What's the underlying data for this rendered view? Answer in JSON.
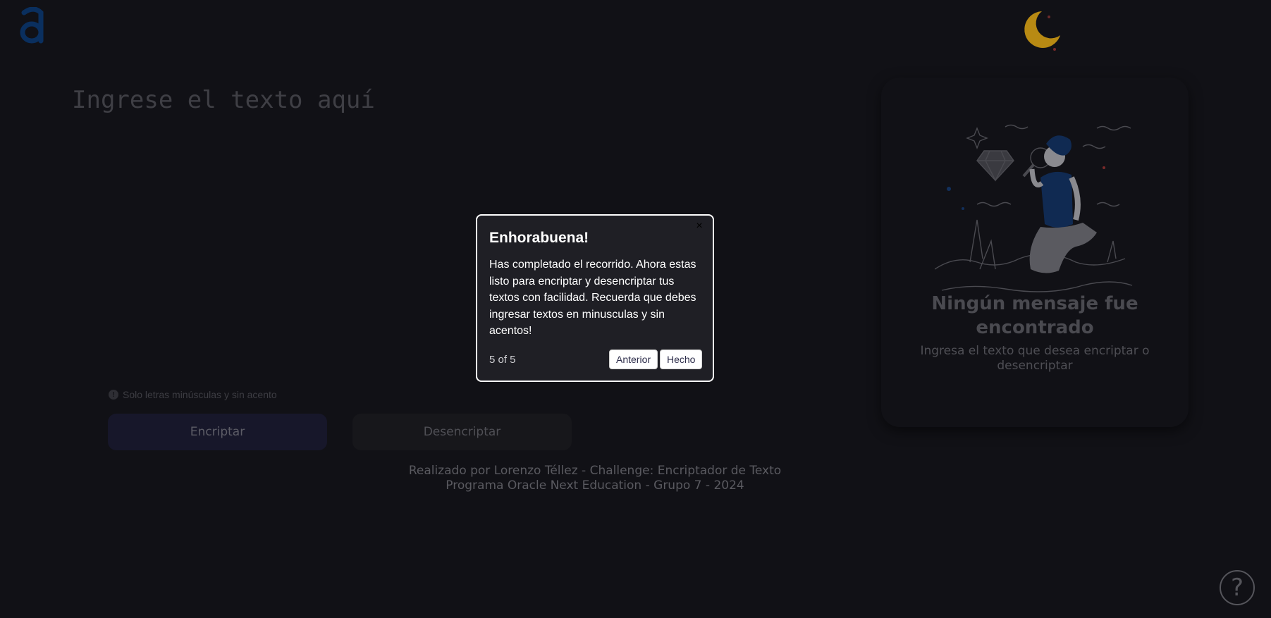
{
  "colors": {
    "background": "#111116",
    "logo": "#0a2f5e",
    "moon": "#b88a13",
    "popover_bg": "#1f1f25",
    "popover_border": "#ffffff"
  },
  "input": {
    "placeholder": "Ingrese el texto aquí"
  },
  "hint": {
    "icon": "exclamation-circle-icon",
    "text": "Solo letras minúsculas y sin acento"
  },
  "buttons": {
    "encrypt": "Encriptar",
    "decrypt": "Desencriptar"
  },
  "footer": {
    "line1": "Realizado por Lorenzo Téllez - Challenge: Encriptador de Texto",
    "line2": "Programa Oracle Next Education - Grupo 7 - 2024"
  },
  "result_panel": {
    "title": "Ningún mensaje fue encontrado",
    "subtitle": "Ingresa el texto que desea encriptar o desencriptar"
  },
  "tour": {
    "close": "×",
    "title": "Enhorabuena!",
    "description": "Has completado el recorrido. Ahora estas listo para encriptar y desencriptar tus textos con facilidad. Recuerda que debes ingresar textos en minusculas y sin acentos!",
    "progress": "5 of 5",
    "prev": "Anterior",
    "done": "Hecho"
  },
  "help": {
    "icon": "question-mark-icon",
    "label": "?"
  }
}
